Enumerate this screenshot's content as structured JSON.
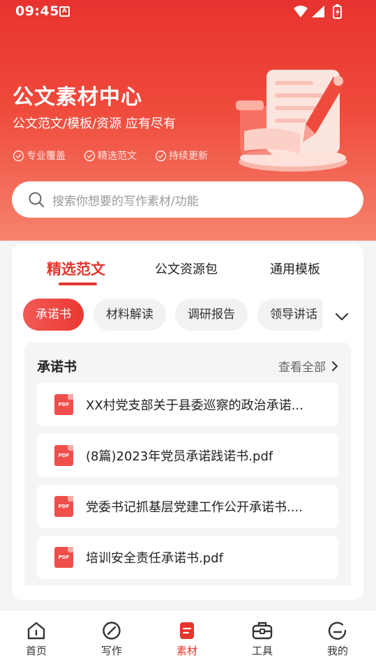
{
  "status_bar": {
    "time": "09:45",
    "notification_icon": "A"
  },
  "hero": {
    "title": "公文素材中心",
    "subtitle": "公文范文/模板/资源 应有尽有",
    "features": [
      "专业覆盖",
      "精选范文",
      "持续更新"
    ]
  },
  "search": {
    "placeholder": "搜索你想要的写作素材/功能"
  },
  "tabs": [
    {
      "label": "精选范文",
      "active": true
    },
    {
      "label": "公文资源包",
      "active": false
    },
    {
      "label": "通用模板",
      "active": false
    }
  ],
  "chips": [
    {
      "label": "承诺书",
      "active": true
    },
    {
      "label": "材料解读",
      "active": false
    },
    {
      "label": "调研报告",
      "active": false
    },
    {
      "label": "领导讲话",
      "active": false
    }
  ],
  "section": {
    "title": "承诺书",
    "more_label": "查看全部",
    "files": [
      {
        "name": "XX村党支部关于县委巡察的政治承诺...",
        "type": "PDF"
      },
      {
        "name": "(8篇)2023年党员承诺践诺书.pdf",
        "type": "PDF"
      },
      {
        "name": "党委书记抓基层党建工作公开承诺书....",
        "type": "PDF"
      },
      {
        "name": "培训安全责任承诺书.pdf",
        "type": "PDF"
      }
    ]
  },
  "bottom_nav": [
    {
      "label": "首页",
      "icon": "home-icon",
      "active": false
    },
    {
      "label": "写作",
      "icon": "pen-circle-icon",
      "active": false
    },
    {
      "label": "素材",
      "icon": "document-icon",
      "active": true
    },
    {
      "label": "工具",
      "icon": "toolbox-icon",
      "active": false
    },
    {
      "label": "我的",
      "icon": "profile-icon",
      "active": false
    }
  ],
  "colors": {
    "accent": "#e6352d",
    "hero_top": "#e8332f",
    "hero_bottom": "#f6836d"
  }
}
